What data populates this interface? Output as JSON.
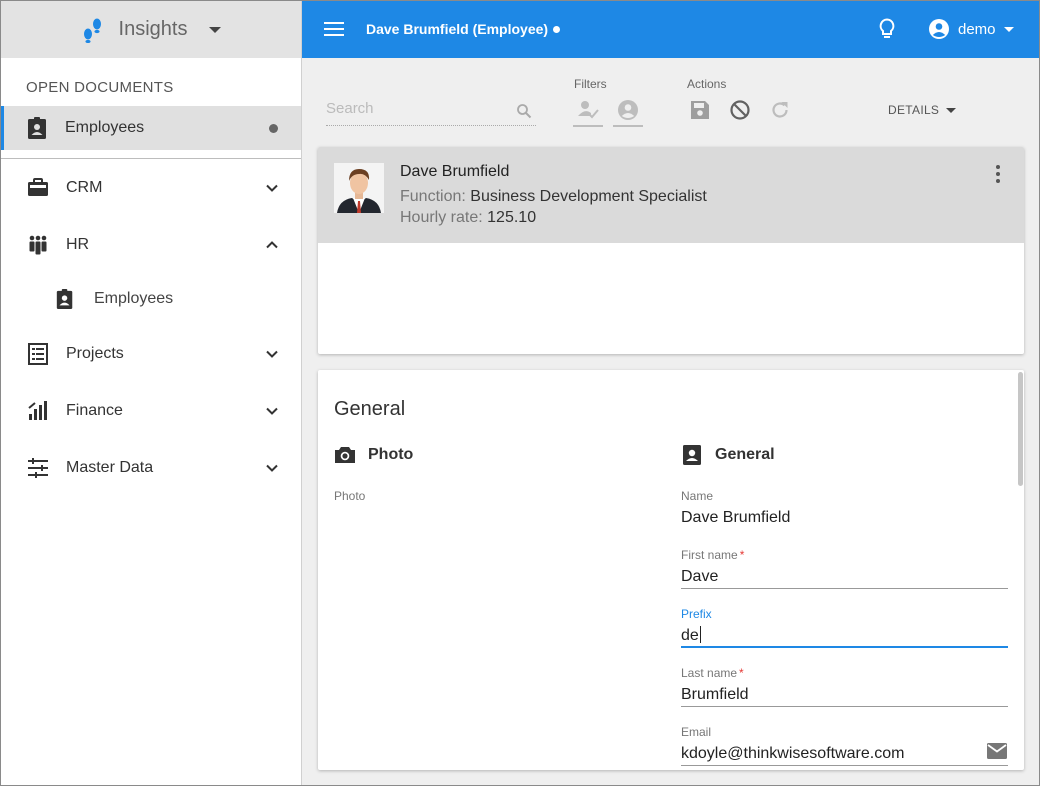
{
  "app": {
    "name": "Insights",
    "brand_color": "#1e88e5"
  },
  "sidebar": {
    "open_documents_title": "OPEN DOCUMENTS",
    "open_documents": [
      {
        "label": "Employees",
        "icon": "badge-icon"
      }
    ],
    "items": [
      {
        "label": "CRM",
        "icon": "briefcase-icon",
        "expanded": false
      },
      {
        "label": "HR",
        "icon": "people-icon",
        "expanded": true,
        "children": [
          {
            "label": "Employees",
            "icon": "badge-icon"
          }
        ]
      },
      {
        "label": "Projects",
        "icon": "list-icon",
        "expanded": false
      },
      {
        "label": "Finance",
        "icon": "chart-icon",
        "expanded": false
      },
      {
        "label": "Master Data",
        "icon": "tune-icon",
        "expanded": false
      }
    ]
  },
  "header": {
    "title": "Dave Brumfield (Employee)",
    "user": "demo"
  },
  "toolbar": {
    "search_placeholder": "Search",
    "filters_label": "Filters",
    "actions_label": "Actions",
    "details_label": "DETAILS"
  },
  "record": {
    "name": "Dave Brumfield",
    "function_key": "Function:",
    "function_value": "Business Development Specialist",
    "rate_key": "Hourly rate:",
    "rate_value": "125.10"
  },
  "form": {
    "section_title": "General",
    "photo_group": "Photo",
    "photo_label": "Photo",
    "general_group": "General",
    "fields": [
      {
        "label": "Name",
        "value": "Dave Brumfield",
        "required": false
      },
      {
        "label": "First name",
        "value": "Dave",
        "required": true
      },
      {
        "label": "Prefix",
        "value": "de",
        "required": false
      },
      {
        "label": "Last name",
        "value": "Brumfield",
        "required": true
      },
      {
        "label": "Email",
        "value": "kdoyle@thinkwisesoftware.com",
        "required": false
      }
    ],
    "required_mark": "*"
  }
}
